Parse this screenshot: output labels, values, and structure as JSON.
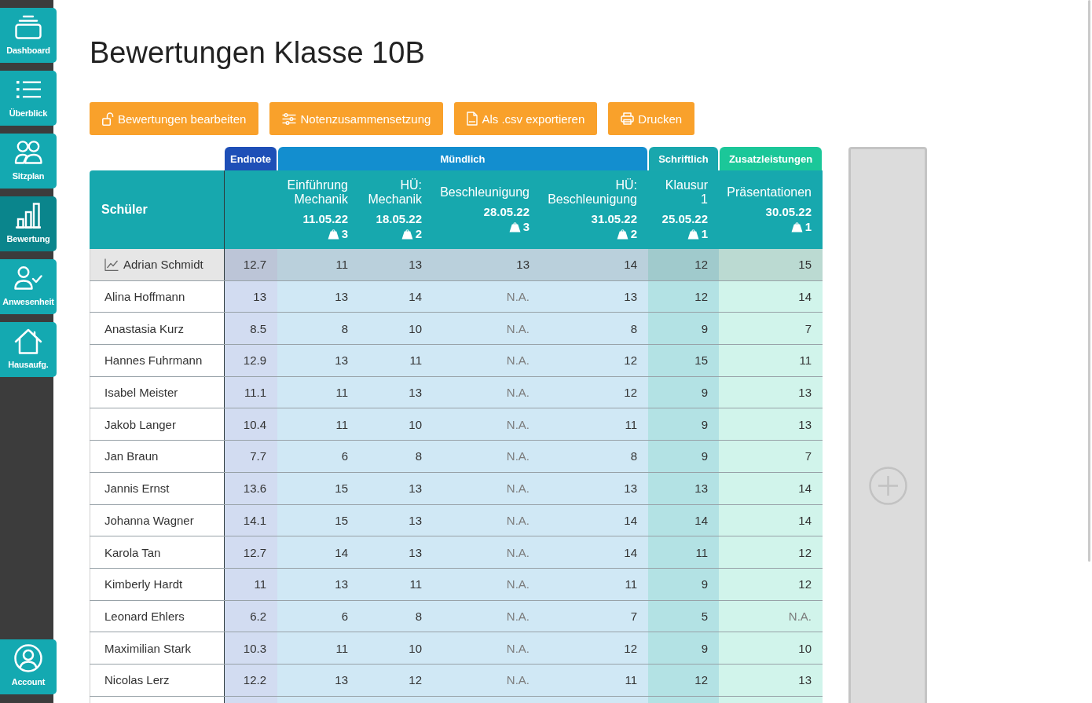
{
  "sidebar": {
    "items": [
      {
        "label": "Dashboard",
        "selected": false
      },
      {
        "label": "Überblick",
        "selected": false
      },
      {
        "label": "Sitzplan",
        "selected": false
      },
      {
        "label": "Bewertung",
        "selected": true
      },
      {
        "label": "Anwesenheit",
        "selected": false
      },
      {
        "label": "Hausaufg.",
        "selected": false
      }
    ],
    "account": {
      "label": "Account"
    }
  },
  "title": "Bewertungen Klasse 10B",
  "toolbar": {
    "buttons": [
      "Bewertungen bearbeiten",
      "Notenzusammensetzung",
      "Als .csv exportieren",
      "Drucken"
    ]
  },
  "table": {
    "student_heading": "Schüler",
    "groups": [
      {
        "label": "Endnote",
        "kind": "final",
        "color": "#1e4fb7"
      },
      {
        "label": "Mündlich",
        "kind": "assessments",
        "color": "#138ecf",
        "columns": [
          {
            "title": "Einführung Mechanik",
            "date": "11.05.22",
            "weight": "3"
          },
          {
            "title": "HÜ: Mechanik",
            "date": "18.05.22",
            "weight": "2"
          },
          {
            "title": "Beschleunigung",
            "date": "28.05.22",
            "weight": "3"
          },
          {
            "title": "HÜ: Beschleunigung",
            "date": "31.05.22",
            "weight": "2"
          }
        ]
      },
      {
        "label": "Schriftlich",
        "kind": "assessments",
        "color": "#19a7ad",
        "columns": [
          {
            "title": "Klausur 1",
            "date": "25.05.22",
            "weight": "1"
          }
        ]
      },
      {
        "label": "Zusatzleistungen",
        "kind": "assessments",
        "color": "#1bc799",
        "columns": [
          {
            "title": "Präsentationen",
            "date": "30.05.22",
            "weight": "1"
          }
        ]
      }
    ],
    "rows": [
      {
        "name": "Adrian Schmidt",
        "selected": true,
        "endnote": "12.7",
        "grades": [
          {
            "value": "11",
            "missing": false
          },
          {
            "value": "13",
            "missing": false
          },
          {
            "value": "13",
            "missing": false
          },
          {
            "value": "14",
            "missing": false
          },
          {
            "value": "12",
            "missing": false
          },
          {
            "value": "15",
            "missing": false
          }
        ]
      },
      {
        "name": "Alina Hoffmann",
        "selected": false,
        "endnote": "13",
        "grades": [
          {
            "value": "13",
            "missing": false
          },
          {
            "value": "14",
            "missing": false
          },
          {
            "value": "N.A.",
            "missing": true
          },
          {
            "value": "13",
            "missing": false
          },
          {
            "value": "12",
            "missing": false
          },
          {
            "value": "14",
            "missing": false
          }
        ]
      },
      {
        "name": "Anastasia Kurz",
        "selected": false,
        "endnote": "8.5",
        "grades": [
          {
            "value": "8",
            "missing": false
          },
          {
            "value": "10",
            "missing": false
          },
          {
            "value": "N.A.",
            "missing": true
          },
          {
            "value": "8",
            "missing": false
          },
          {
            "value": "9",
            "missing": false
          },
          {
            "value": "7",
            "missing": false
          }
        ]
      },
      {
        "name": "Hannes Fuhrmann",
        "selected": false,
        "endnote": "12.9",
        "grades": [
          {
            "value": "13",
            "missing": false
          },
          {
            "value": "11",
            "missing": false
          },
          {
            "value": "N.A.",
            "missing": true
          },
          {
            "value": "12",
            "missing": false
          },
          {
            "value": "15",
            "missing": false
          },
          {
            "value": "11",
            "missing": false
          }
        ]
      },
      {
        "name": "Isabel Meister",
        "selected": false,
        "endnote": "11.1",
        "grades": [
          {
            "value": "11",
            "missing": false
          },
          {
            "value": "13",
            "missing": false
          },
          {
            "value": "N.A.",
            "missing": true
          },
          {
            "value": "12",
            "missing": false
          },
          {
            "value": "9",
            "missing": false
          },
          {
            "value": "13",
            "missing": false
          }
        ]
      },
      {
        "name": "Jakob Langer",
        "selected": false,
        "endnote": "10.4",
        "grades": [
          {
            "value": "11",
            "missing": false
          },
          {
            "value": "10",
            "missing": false
          },
          {
            "value": "N.A.",
            "missing": true
          },
          {
            "value": "11",
            "missing": false
          },
          {
            "value": "9",
            "missing": false
          },
          {
            "value": "13",
            "missing": false
          }
        ]
      },
      {
        "name": "Jan Braun",
        "selected": false,
        "endnote": "7.7",
        "grades": [
          {
            "value": "6",
            "missing": false
          },
          {
            "value": "8",
            "missing": false
          },
          {
            "value": "N.A.",
            "missing": true
          },
          {
            "value": "8",
            "missing": false
          },
          {
            "value": "9",
            "missing": false
          },
          {
            "value": "7",
            "missing": false
          }
        ]
      },
      {
        "name": "Jannis Ernst",
        "selected": false,
        "endnote": "13.6",
        "grades": [
          {
            "value": "15",
            "missing": false
          },
          {
            "value": "13",
            "missing": false
          },
          {
            "value": "N.A.",
            "missing": true
          },
          {
            "value": "13",
            "missing": false
          },
          {
            "value": "13",
            "missing": false
          },
          {
            "value": "14",
            "missing": false
          }
        ]
      },
      {
        "name": "Johanna Wagner",
        "selected": false,
        "endnote": "14.1",
        "grades": [
          {
            "value": "15",
            "missing": false
          },
          {
            "value": "13",
            "missing": false
          },
          {
            "value": "N.A.",
            "missing": true
          },
          {
            "value": "14",
            "missing": false
          },
          {
            "value": "14",
            "missing": false
          },
          {
            "value": "14",
            "missing": false
          }
        ]
      },
      {
        "name": "Karola Tan",
        "selected": false,
        "endnote": "12.7",
        "grades": [
          {
            "value": "14",
            "missing": false
          },
          {
            "value": "13",
            "missing": false
          },
          {
            "value": "N.A.",
            "missing": true
          },
          {
            "value": "14",
            "missing": false
          },
          {
            "value": "11",
            "missing": false
          },
          {
            "value": "12",
            "missing": false
          }
        ]
      },
      {
        "name": "Kimberly Hardt",
        "selected": false,
        "endnote": "11",
        "grades": [
          {
            "value": "13",
            "missing": false
          },
          {
            "value": "11",
            "missing": false
          },
          {
            "value": "N.A.",
            "missing": true
          },
          {
            "value": "11",
            "missing": false
          },
          {
            "value": "9",
            "missing": false
          },
          {
            "value": "12",
            "missing": false
          }
        ]
      },
      {
        "name": "Leonard Ehlers",
        "selected": false,
        "endnote": "6.2",
        "grades": [
          {
            "value": "6",
            "missing": false
          },
          {
            "value": "8",
            "missing": false
          },
          {
            "value": "N.A.",
            "missing": true
          },
          {
            "value": "7",
            "missing": false
          },
          {
            "value": "5",
            "missing": false
          },
          {
            "value": "N.A.",
            "missing": true
          }
        ]
      },
      {
        "name": "Maximilian Stark",
        "selected": false,
        "endnote": "10.3",
        "grades": [
          {
            "value": "11",
            "missing": false
          },
          {
            "value": "10",
            "missing": false
          },
          {
            "value": "N.A.",
            "missing": true
          },
          {
            "value": "12",
            "missing": false
          },
          {
            "value": "9",
            "missing": false
          },
          {
            "value": "10",
            "missing": false
          }
        ]
      },
      {
        "name": "Nicolas Lerz",
        "selected": false,
        "endnote": "12.2",
        "grades": [
          {
            "value": "13",
            "missing": false
          },
          {
            "value": "12",
            "missing": false
          },
          {
            "value": "N.A.",
            "missing": true
          },
          {
            "value": "11",
            "missing": false
          },
          {
            "value": "12",
            "missing": false
          },
          {
            "value": "13",
            "missing": false
          }
        ]
      }
    ]
  }
}
